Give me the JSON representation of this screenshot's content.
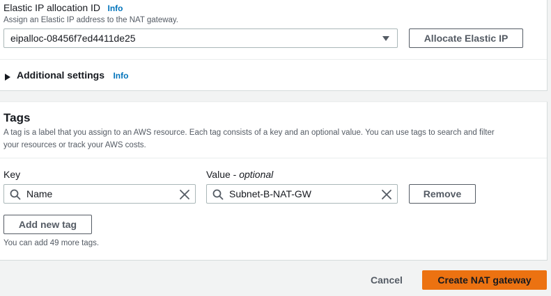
{
  "eip": {
    "label": "Elastic IP allocation ID",
    "info": "Info",
    "description": "Assign an Elastic IP address to the NAT gateway.",
    "selected_value": "eipalloc-08456f7ed4411de25",
    "allocate_button": "Allocate Elastic IP"
  },
  "additional_settings": {
    "label": "Additional settings",
    "info": "Info"
  },
  "tags": {
    "title": "Tags",
    "description_line1": "A tag is a label that you assign to an AWS resource. Each tag consists of a key and an optional value. You can use tags to search and filter",
    "description_line2": "your resources or track your AWS costs.",
    "key_header": "Key",
    "value_header": "Value - ",
    "value_header_optional": "optional",
    "rows": [
      {
        "key": "Name",
        "value": "Subnet-B-NAT-GW",
        "remove_label": "Remove"
      }
    ],
    "add_button": "Add new tag",
    "remaining_note": "You can add 49 more tags."
  },
  "footer": {
    "cancel": "Cancel",
    "create": "Create NAT gateway"
  },
  "colors": {
    "primary_button": "#ec7211",
    "link": "#0073bb",
    "page_background": "#f2f3f3"
  },
  "icons": [
    "caret-down-icon",
    "caret-right-icon",
    "search-icon",
    "close-icon"
  ]
}
